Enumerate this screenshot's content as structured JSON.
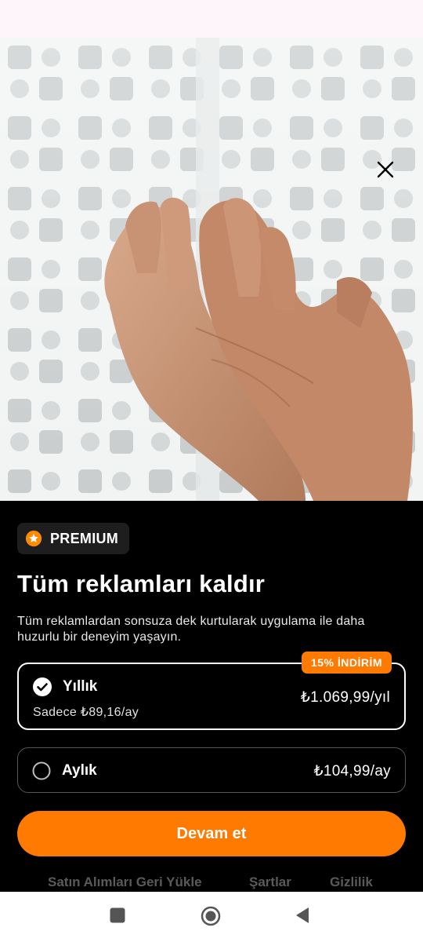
{
  "status_bar": {
    "time": "",
    "left_text": "",
    "right_text": ""
  },
  "hero": {
    "close_icon": "close-icon"
  },
  "badge": {
    "label": "PREMIUM",
    "icon": "star-icon"
  },
  "title": "Tüm reklamları kaldır",
  "description": "Tüm reklamlardan sonsuza dek kurtularak uygulama ile daha huzurlu bir deneyim yaşayın.",
  "plans": [
    {
      "name": "Yıllık",
      "subtitle": "Sadece ₺89,16/ay",
      "price": "₺1.069,99/yıl",
      "badge": "15% İNDİRİM",
      "selected": true
    },
    {
      "name": "Aylık",
      "price": "₺104,99/ay",
      "selected": false
    }
  ],
  "cta": {
    "label": "Devam et"
  },
  "footer": {
    "restore": "Satın Alımları Geri Yükle",
    "terms": "Şartlar",
    "privacy": "Gizlilik"
  },
  "colors": {
    "accent": "#ff7a00",
    "background": "#000000",
    "badge_bg": "#1e1e1e"
  },
  "nav_bar": {
    "icons": [
      "square-icon",
      "circle-home-icon",
      "triangle-back-icon"
    ]
  }
}
